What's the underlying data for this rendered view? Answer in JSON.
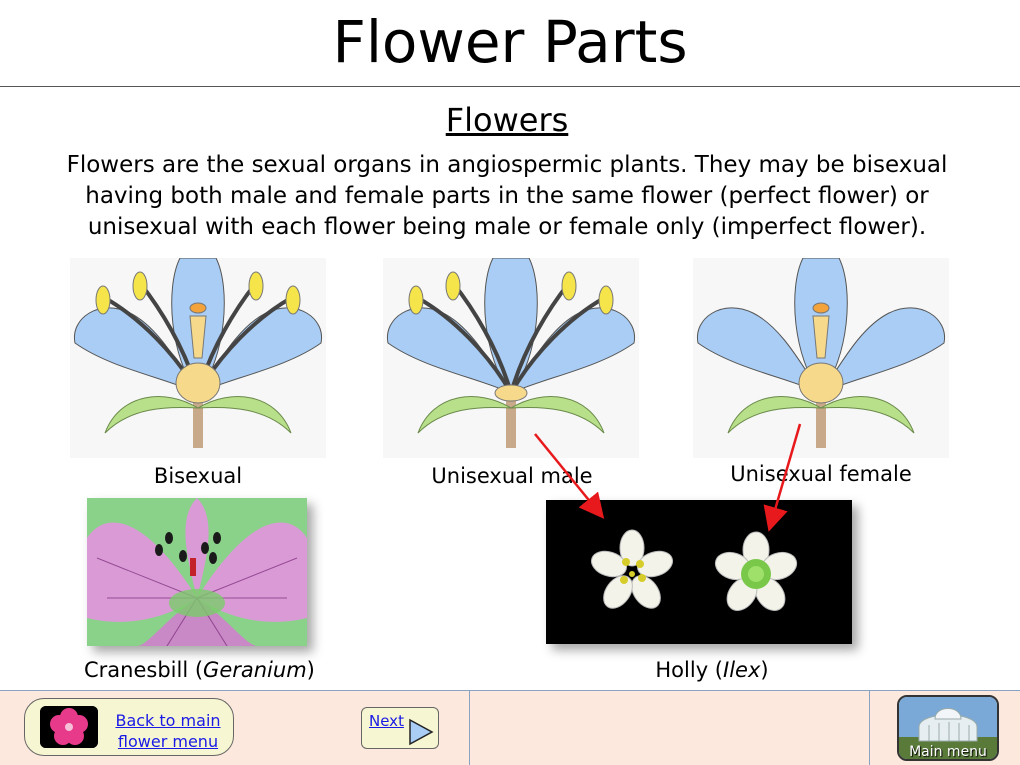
{
  "header": {
    "title": "Flower Parts"
  },
  "section": {
    "subtitle": "Flowers",
    "intro": "Flowers are the sexual organs in angiospermic plants. They may be bisexual having both male and female parts in the same flower (perfect flower) or unisexual with each flower being male or female only (imperfect flower)."
  },
  "diagrams": {
    "bisexual_caption": "Bisexual",
    "male_caption": "Unisexual male",
    "female_caption": "Unisexual female"
  },
  "photos": {
    "geranium_caption_common": "Cranesbill (",
    "geranium_caption_latin": "Geranium",
    "geranium_caption_end": ")",
    "holly_caption_common": "Holly (",
    "holly_caption_latin": "Ilex",
    "holly_caption_end": ")"
  },
  "footer": {
    "back_label_line1": "Back to main",
    "back_label_line2": "flower menu",
    "next_label": "Next",
    "main_menu_label": "Main menu"
  },
  "colors": {
    "petal": "#a9cdf5",
    "receptacle": "#f6d98a",
    "sepal": "#b8df8a",
    "anther": "#f5e54a",
    "arrow": "#e8191c",
    "footer_bg": "#fce8dc"
  }
}
